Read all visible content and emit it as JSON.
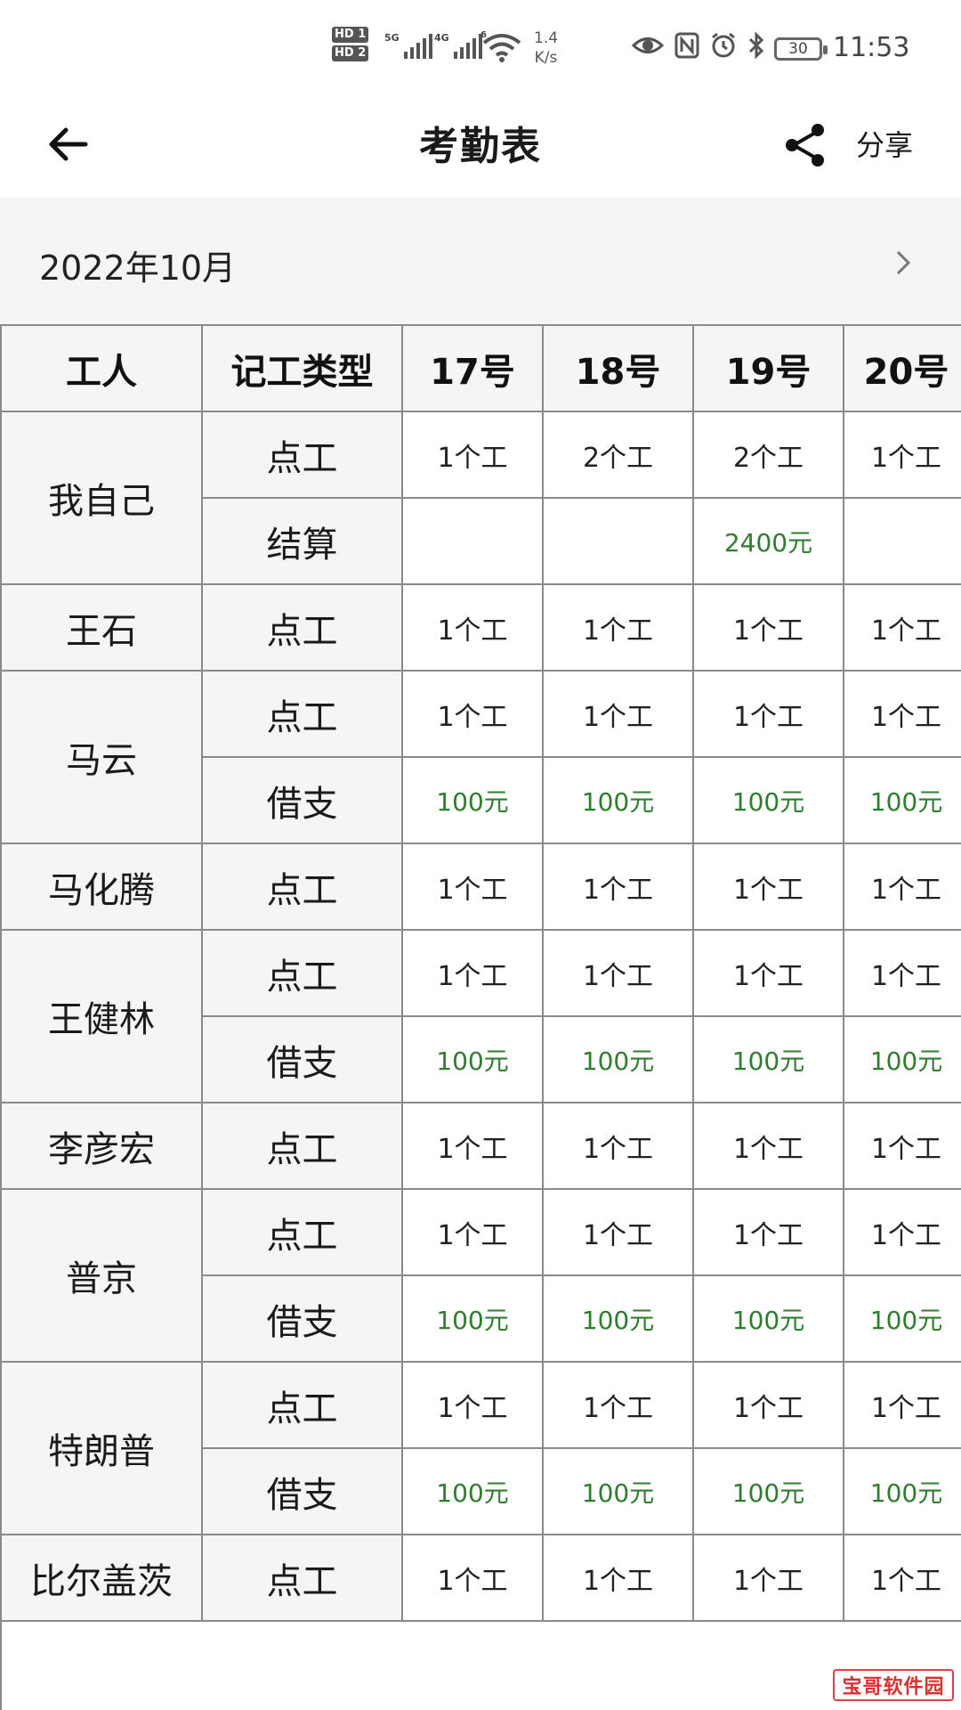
{
  "status_bar": {
    "hd1": "HD 1",
    "hd2": "HD 2",
    "sim1_label": "5G",
    "sim2_label": "4G",
    "wifi_label": "6",
    "net_speed_value": "1.4",
    "net_speed_unit": "K/s",
    "battery": "30",
    "time": "11:53",
    "icons": [
      "eye-icon",
      "nfc-icon",
      "alarm-icon",
      "bluetooth-icon"
    ]
  },
  "app_bar": {
    "title": "考勤表",
    "share_label": "分享",
    "back_icon": "arrow-left-icon",
    "share_icon": "share-icon"
  },
  "month": {
    "label": "2022年10月",
    "next_icon": "chevron-right-icon"
  },
  "table": {
    "headers": [
      "工人",
      "记工类型",
      "17号",
      "18号",
      "19号",
      "20号"
    ],
    "workers": [
      {
        "name": "我自己",
        "rows": [
          {
            "type": "点工",
            "values": [
              "1个工",
              "2个工",
              "2个工",
              "1个工"
            ],
            "money": false
          },
          {
            "type": "结算",
            "values": [
              "",
              "",
              "2400元",
              ""
            ],
            "money": true
          }
        ]
      },
      {
        "name": "王石",
        "rows": [
          {
            "type": "点工",
            "values": [
              "1个工",
              "1个工",
              "1个工",
              "1个工"
            ],
            "money": false
          }
        ]
      },
      {
        "name": "马云",
        "rows": [
          {
            "type": "点工",
            "values": [
              "1个工",
              "1个工",
              "1个工",
              "1个工"
            ],
            "money": false
          },
          {
            "type": "借支",
            "values": [
              "100元",
              "100元",
              "100元",
              "100元"
            ],
            "money": true
          }
        ]
      },
      {
        "name": "马化腾",
        "rows": [
          {
            "type": "点工",
            "values": [
              "1个工",
              "1个工",
              "1个工",
              "1个工"
            ],
            "money": false
          }
        ]
      },
      {
        "name": "王健林",
        "rows": [
          {
            "type": "点工",
            "values": [
              "1个工",
              "1个工",
              "1个工",
              "1个工"
            ],
            "money": false
          },
          {
            "type": "借支",
            "values": [
              "100元",
              "100元",
              "100元",
              "100元"
            ],
            "money": true
          }
        ]
      },
      {
        "name": "李彦宏",
        "rows": [
          {
            "type": "点工",
            "values": [
              "1个工",
              "1个工",
              "1个工",
              "1个工"
            ],
            "money": false
          }
        ]
      },
      {
        "name": "普京",
        "rows": [
          {
            "type": "点工",
            "values": [
              "1个工",
              "1个工",
              "1个工",
              "1个工"
            ],
            "money": false
          },
          {
            "type": "借支",
            "values": [
              "100元",
              "100元",
              "100元",
              "100元"
            ],
            "money": true
          }
        ]
      },
      {
        "name": "特朗普",
        "rows": [
          {
            "type": "点工",
            "values": [
              "1个工",
              "1个工",
              "1个工",
              "1个工"
            ],
            "money": false
          },
          {
            "type": "借支",
            "values": [
              "100元",
              "100元",
              "100元",
              "100元"
            ],
            "money": true
          }
        ]
      },
      {
        "name": "比尔盖茨",
        "rows": [
          {
            "type": "点工",
            "values": [
              "1个工",
              "1个工",
              "1个工",
              "1个工"
            ],
            "money": false
          }
        ]
      }
    ]
  },
  "colors": {
    "money_green": "#2f7d2f",
    "header_bg": "#f5f5f5",
    "grid_line": "#8a8a8a",
    "watermark_red": "#d93030"
  },
  "watermark": "宝哥软件园"
}
